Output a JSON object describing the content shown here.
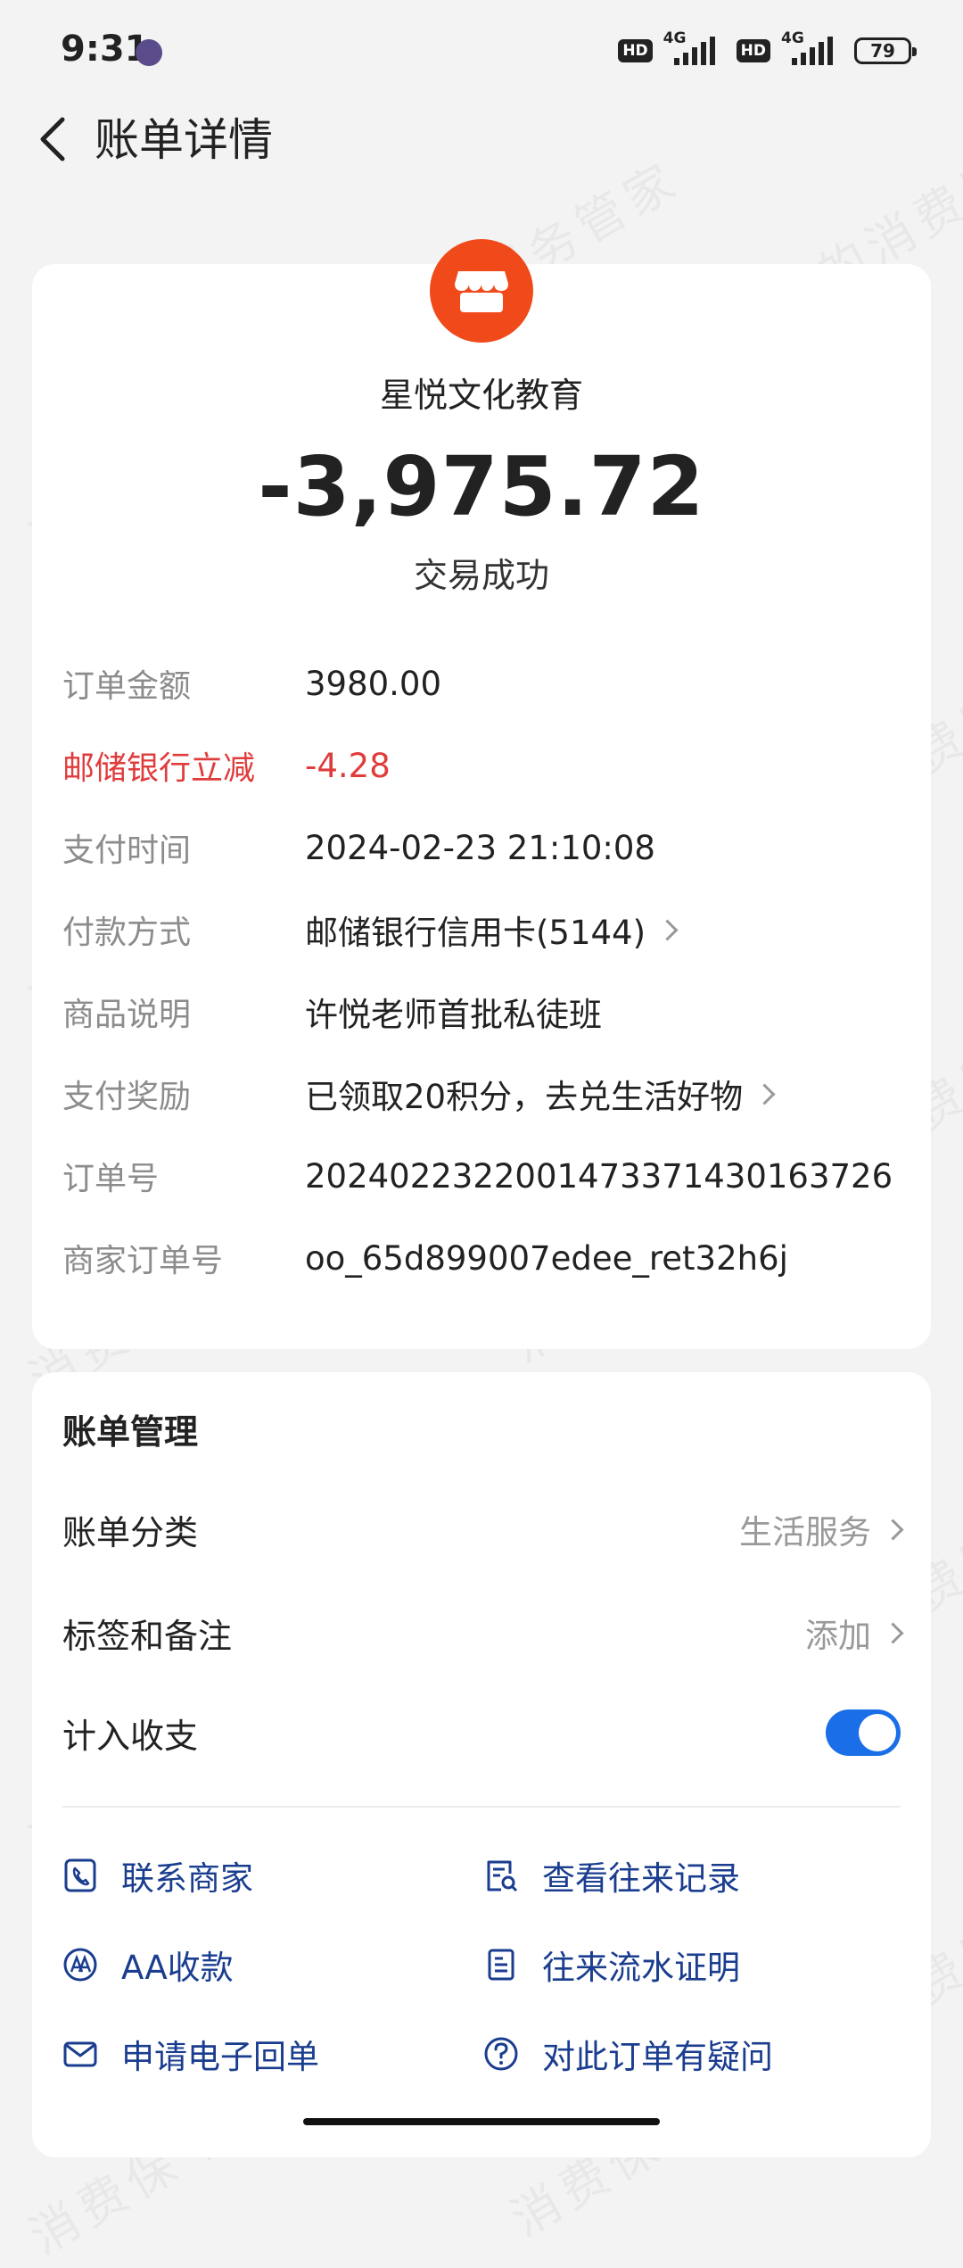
{
  "status_bar": {
    "time": "9:31",
    "hd1": "HD",
    "net1": "4G",
    "hd2": "HD",
    "net2": "4G",
    "battery": "79"
  },
  "nav": {
    "title": "账单详情"
  },
  "bill": {
    "merchant": "星悦文化教育",
    "amount": "-3,975.72",
    "status": "交易成功",
    "details": [
      {
        "key": "订单金额",
        "value": "3980.00"
      },
      {
        "key": "邮储银行立减",
        "value": "-4.28"
      },
      {
        "key": "支付时间",
        "value": "2024-02-23 21:10:08"
      },
      {
        "key": "付款方式",
        "value": "邮储银行信用卡(5144)"
      },
      {
        "key": "商品说明",
        "value": "许悦老师首批私徒班"
      },
      {
        "key": "支付奖励",
        "value": "已领取20积分，去兑生活好物"
      },
      {
        "key": "订单号",
        "value": "2024022322001473371430163726"
      },
      {
        "key": "商家订单号",
        "value": "oo_65d899007edee_ret32h6j"
      }
    ]
  },
  "management": {
    "title": "账单管理",
    "category_label": "账单分类",
    "category_value": "生活服务",
    "tags_label": "标签和备注",
    "tags_value": "添加",
    "include_label": "计入收支",
    "include_enabled": true,
    "actions": [
      {
        "label": "联系商家",
        "icon": "phone-icon"
      },
      {
        "label": "查看往来记录",
        "icon": "records-search-icon"
      },
      {
        "label": "AA收款",
        "icon": "aa-icon"
      },
      {
        "label": "往来流水证明",
        "icon": "document-icon"
      },
      {
        "label": "申请电子回单",
        "icon": "mail-icon"
      },
      {
        "label": "对此订单有疑问",
        "icon": "question-icon"
      }
    ]
  },
  "watermark": "消费保 您身边的消费服务管家",
  "colors": {
    "accent": "#1a6fe8",
    "merchant_logo": "#f04a1a",
    "discount": "#e03c3c",
    "action_text": "#1a3d8f"
  }
}
